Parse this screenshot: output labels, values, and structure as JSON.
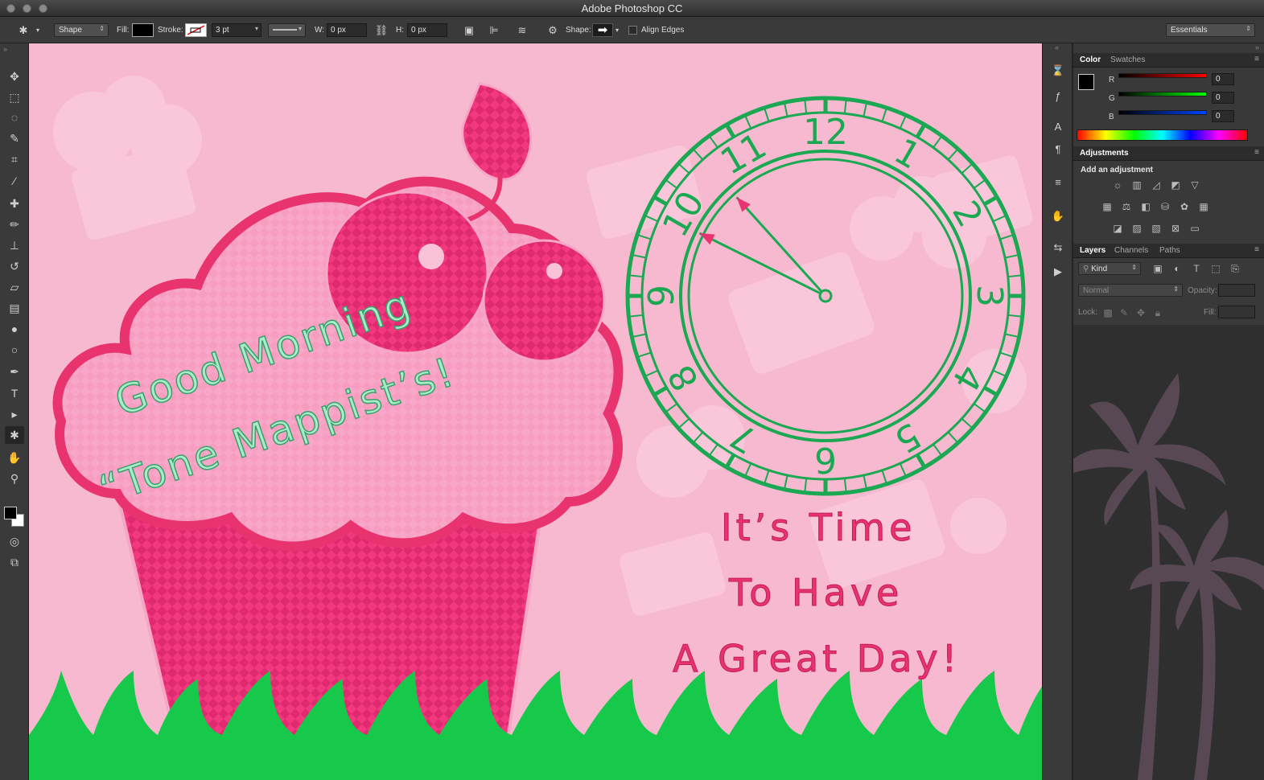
{
  "app": {
    "title": "Adobe Photoshop CC"
  },
  "options_bar": {
    "tool_mode": "Shape",
    "fill_label": "Fill:",
    "stroke_label": "Stroke:",
    "stroke_width": "3 pt",
    "w_label": "W:",
    "w_value": "0 px",
    "h_label": "H:",
    "h_value": "0 px",
    "shape_label": "Shape:",
    "align_edges_label": "Align Edges",
    "workspace": "Essentials"
  },
  "tools": [
    {
      "name": "move-tool",
      "glyph": "✥"
    },
    {
      "name": "marquee-tool",
      "glyph": "⬚"
    },
    {
      "name": "lasso-tool",
      "glyph": "◌"
    },
    {
      "name": "quick-select-tool",
      "glyph": "✎"
    },
    {
      "name": "crop-tool",
      "glyph": "⌗"
    },
    {
      "name": "eyedropper-tool",
      "glyph": "⁄"
    },
    {
      "name": "healing-brush-tool",
      "glyph": "✚"
    },
    {
      "name": "brush-tool",
      "glyph": "✏"
    },
    {
      "name": "clone-stamp-tool",
      "glyph": "⊥"
    },
    {
      "name": "history-brush-tool",
      "glyph": "↺"
    },
    {
      "name": "eraser-tool",
      "glyph": "▱"
    },
    {
      "name": "gradient-tool",
      "glyph": "▤"
    },
    {
      "name": "blur-tool",
      "glyph": "●"
    },
    {
      "name": "dodge-tool",
      "glyph": "○"
    },
    {
      "name": "pen-tool",
      "glyph": "✒"
    },
    {
      "name": "type-tool",
      "glyph": "T"
    },
    {
      "name": "path-select-tool",
      "glyph": "▸"
    },
    {
      "name": "custom-shape-tool",
      "glyph": "✱"
    },
    {
      "name": "hand-tool",
      "glyph": "✋"
    },
    {
      "name": "zoom-tool",
      "glyph": "⚲"
    }
  ],
  "canvas": {
    "greeting_line1": "Good Morning",
    "greeting_line2": "“Tone Mappist’s!",
    "message_line1": "It’s Time",
    "message_line2": "To Have",
    "message_line3": "A Great Day!",
    "clock_numbers": [
      "12",
      "1",
      "2",
      "3",
      "4",
      "5",
      "6",
      "7",
      "8",
      "9",
      "10",
      "11"
    ],
    "clock_hour": 9,
    "clock_minute": 53,
    "colors": {
      "background": "#f7b9cf",
      "cupcake": "#f2397f",
      "frosting": "#f9a3c6",
      "clock": "#1aa852",
      "hands": "#e8336f",
      "greeting_text": "#a8ecc8",
      "message_text": "#e8336f",
      "grass": "#17c94a"
    }
  },
  "color_panel": {
    "tabs": [
      "Color",
      "Swatches"
    ],
    "channels": [
      {
        "label": "R",
        "value": "0"
      },
      {
        "label": "G",
        "value": "0"
      },
      {
        "label": "B",
        "value": "0"
      }
    ]
  },
  "adjustments_panel": {
    "tab": "Adjustments",
    "heading": "Add an adjustment"
  },
  "layers_panel": {
    "tabs": [
      "Layers",
      "Channels",
      "Paths"
    ],
    "filter_kind": "Kind",
    "blend_mode": "Normal",
    "opacity_label": "Opacity:",
    "lock_label": "Lock:",
    "fill_label": "Fill:"
  }
}
